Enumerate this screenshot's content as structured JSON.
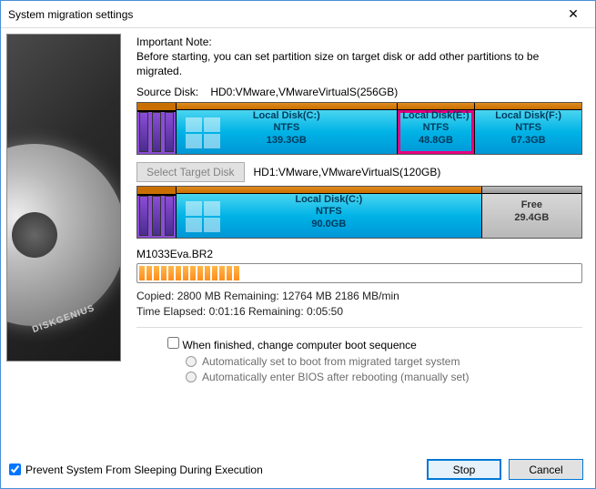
{
  "window": {
    "title": "System migration settings"
  },
  "note": {
    "title": "Important Note:",
    "body": "Before starting, you can set partition size on target disk or add other partitions to be migrated."
  },
  "source": {
    "label": "Source Disk:",
    "value": "HD0:VMware,VMwareVirtualS(256GB)",
    "partitions": [
      {
        "name": "Local Disk(C:)",
        "fs": "NTFS",
        "size": "139.3GB"
      },
      {
        "name": "Local Disk(E:)",
        "fs": "NTFS",
        "size": "48.8GB"
      },
      {
        "name": "Local Disk(F:)",
        "fs": "NTFS",
        "size": "67.3GB"
      }
    ]
  },
  "target": {
    "button": "Select Target Disk",
    "value": "HD1:VMware,VMwareVirtualS(120GB)",
    "partitions": [
      {
        "name": "Local Disk(C:)",
        "fs": "NTFS",
        "size": "90.0GB"
      },
      {
        "name": "Free",
        "size": "29.4GB"
      }
    ]
  },
  "progress": {
    "file": "M1033Eva.BR2",
    "line1": "Copied:   2800 MB   Remaining:   12764 MB   2186 MB/min",
    "line2": "Time Elapsed:   0:01:16   Remaining:   0:05:50"
  },
  "options": {
    "boot_sequence": "When finished, change computer boot sequence",
    "auto_boot": "Automatically set to boot from migrated target system",
    "enter_bios": "Automatically enter BIOS after rebooting (manually set)"
  },
  "footer": {
    "prevent_sleep": "Prevent System From Sleeping During Execution",
    "stop": "Stop",
    "cancel": "Cancel"
  },
  "brand": "DISKGENIUS"
}
